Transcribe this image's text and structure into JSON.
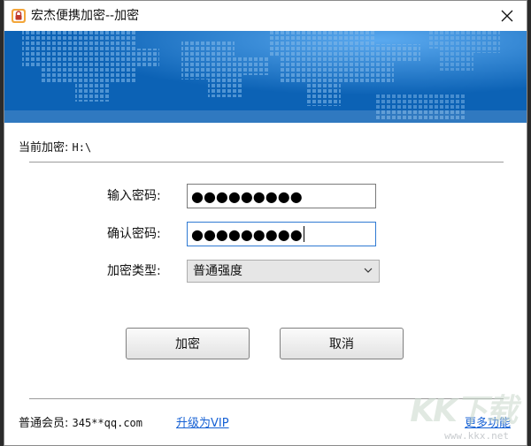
{
  "window": {
    "title": "宏杰便携加密--加密",
    "app_icon": "lock-icon",
    "close_icon": "close-icon"
  },
  "banner": {
    "accent": "#0c62b5"
  },
  "current": {
    "label": "当前加密:",
    "path": "H:\\"
  },
  "form": {
    "password_label": "输入密码:",
    "password_value": "●●●●●●●●●",
    "confirm_label": "确认密码:",
    "confirm_value": "●●●●●●●●●",
    "type_label": "加密类型:",
    "type_selected": "普通强度"
  },
  "buttons": {
    "encrypt": "加密",
    "cancel": "取消"
  },
  "footer": {
    "member_label": "普通会员:",
    "account": "345**qq.com",
    "upgrade_link": "升级为VIP",
    "more_link": "更多功能"
  },
  "watermark": {
    "logo": "KK下载",
    "url": "www.kkx.net"
  }
}
